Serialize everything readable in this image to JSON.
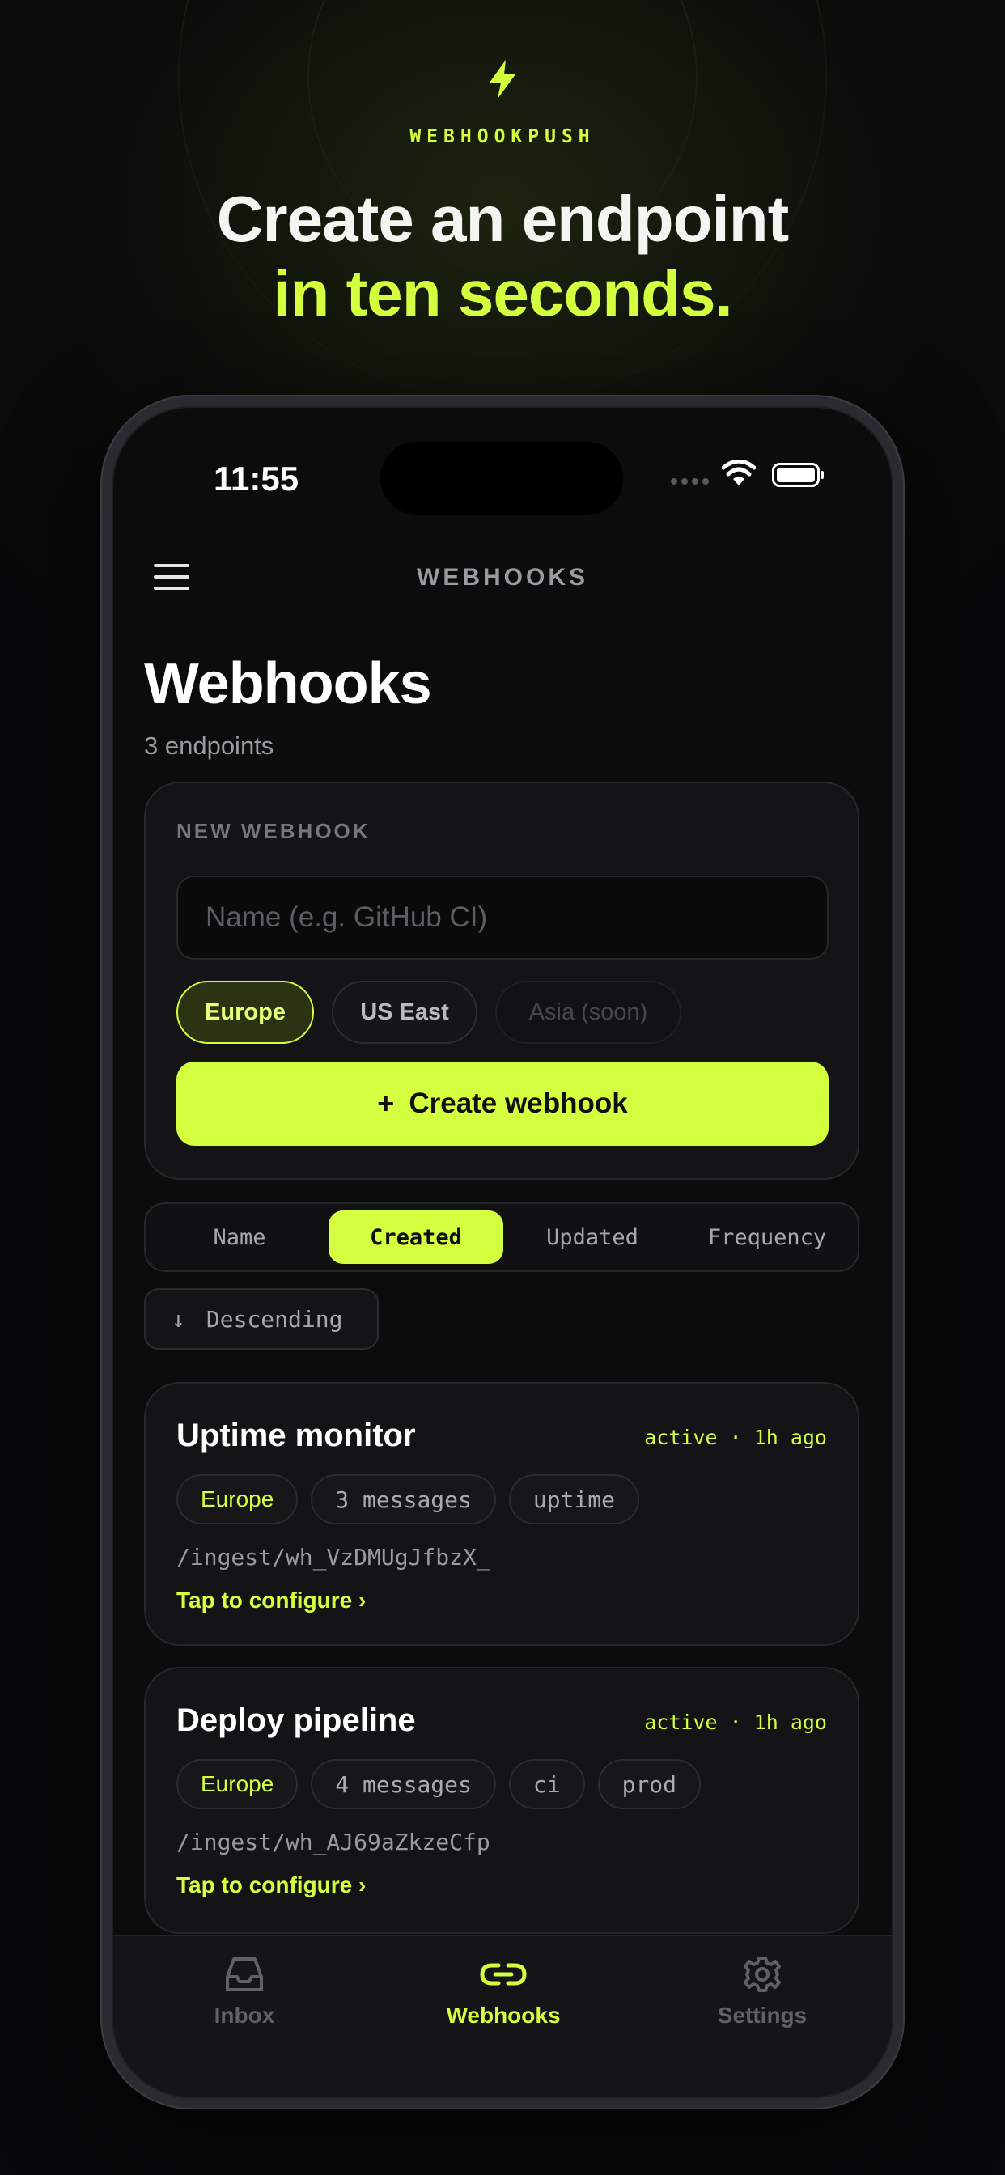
{
  "hero": {
    "brand": "WEBHOOKPUSH",
    "headline_line1": "Create an endpoint",
    "headline_line2": "in ten seconds."
  },
  "status_bar": {
    "time": "11:55"
  },
  "nav": {
    "title": "WEBHOOKS"
  },
  "page": {
    "title": "Webhooks",
    "subtitle": "3 endpoints"
  },
  "new_webhook": {
    "label": "NEW WEBHOOK",
    "name_value": "",
    "name_placeholder": "Name (e.g. GitHub CI)",
    "regions": [
      {
        "label": "Europe",
        "state": "selected"
      },
      {
        "label": "US East",
        "state": "available"
      },
      {
        "label": "Asia (soon)",
        "state": "disabled"
      }
    ],
    "create_plus": "+",
    "create_label": "Create webhook"
  },
  "sort": {
    "options": [
      "Name",
      "Created",
      "Updated",
      "Frequency"
    ],
    "selected": "Created",
    "order_arrow": "↓",
    "order_label": "Descending"
  },
  "webhooks": [
    {
      "name": "Uptime monitor",
      "meta": "active · 1h ago",
      "region": "Europe",
      "tags": [
        "3 messages",
        "uptime"
      ],
      "path": "/ingest/wh_VzDMUgJfbzX_",
      "link": "Tap to configure ›"
    },
    {
      "name": "Deploy pipeline",
      "meta": "active · 1h ago",
      "region": "Europe",
      "tags": [
        "4 messages",
        "ci",
        "prod"
      ],
      "path": "/ingest/wh_AJ69aZkzeCfp",
      "link": "Tap to configure ›"
    }
  ],
  "tabbar": {
    "items": [
      {
        "label": "Inbox",
        "icon": "inbox-icon"
      },
      {
        "label": "Webhooks",
        "icon": "link-icon",
        "active": true
      },
      {
        "label": "Settings",
        "icon": "gear-icon"
      }
    ]
  },
  "colors": {
    "accent": "#d4ff3f",
    "background": "#0c0c0d",
    "card": "#141416"
  }
}
